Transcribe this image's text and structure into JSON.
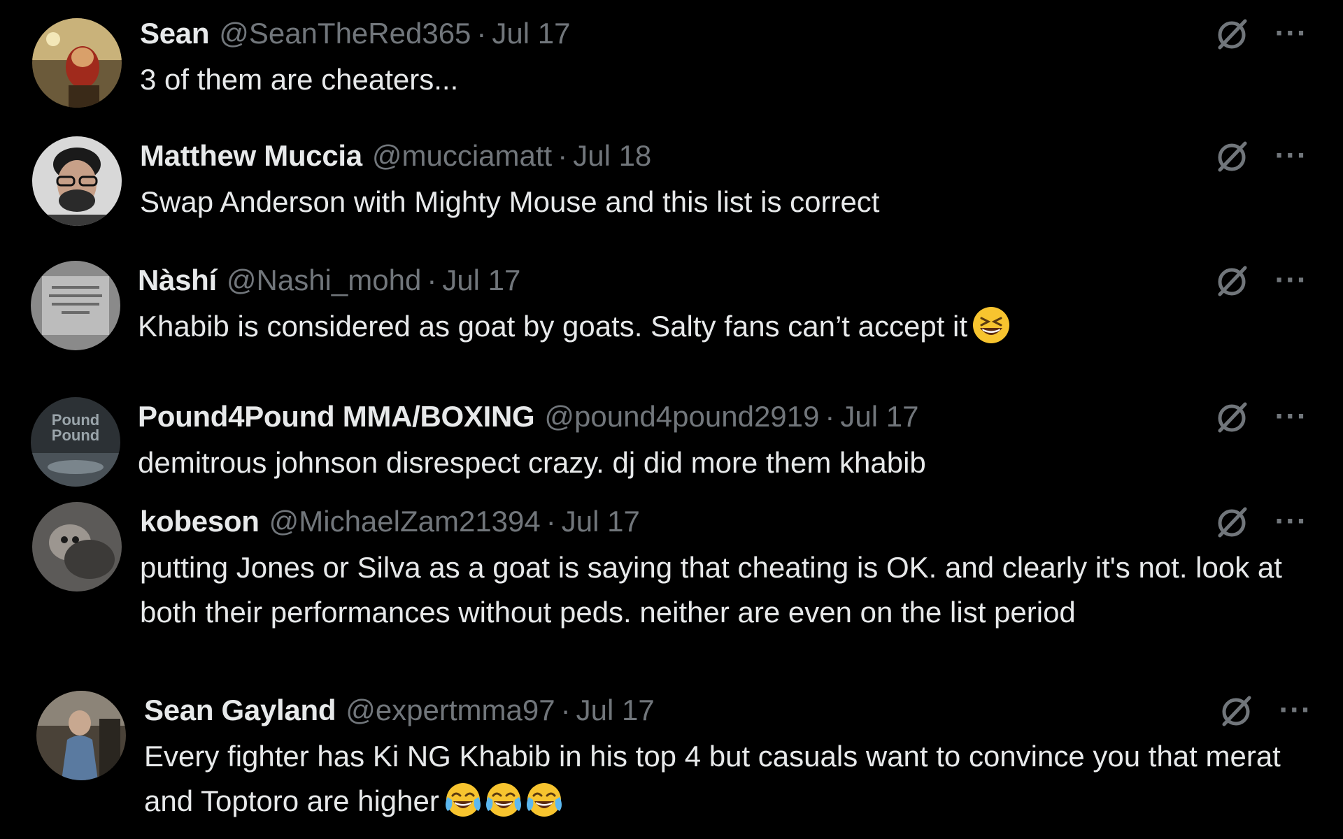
{
  "replies": [
    {
      "name": "Sean",
      "handle": "@SeanTheRed365",
      "separator": "·",
      "date": "Jul 17",
      "text": "3 of them are cheaters...",
      "emojis": []
    },
    {
      "name": "Matthew Muccia",
      "handle": "@mucciamatt",
      "separator": "·",
      "date": "Jul 18",
      "text": "Swap Anderson with Mighty Mouse and this list is correct",
      "emojis": []
    },
    {
      "name": "Nàshí",
      "handle": "@Nashi_mohd",
      "separator": "·",
      "date": "Jul 17",
      "text": "Khabib is considered as goat by goats. Salty fans can’t accept it",
      "emojis": [
        "grinning-squinting-face"
      ]
    },
    {
      "name": "Pound4Pound MMA/BOXING",
      "handle": "@pound4pound2919",
      "separator": "·",
      "date": "Jul 17",
      "text": "demitrous johnson disrespect crazy. dj did more them khabib",
      "emojis": []
    },
    {
      "name": "kobeson",
      "handle": "@MichaelZam21394",
      "separator": "·",
      "date": "Jul 17",
      "text": "putting Jones or Silva as a goat is saying that cheating is OK. and clearly it's not. look at both their performances without peds.  neither are even on the list period",
      "emojis": []
    },
    {
      "name": "Sean Gayland",
      "handle": "@expertmma97",
      "separator": "·",
      "date": "Jul 17",
      "text": "Every fighter has Ki NG Khabib in his top 4 but casuals want to convince you that merat and Toptoro are higher",
      "emojis": [
        "face-with-tears-of-joy",
        "face-with-tears-of-joy",
        "face-with-tears-of-joy"
      ]
    }
  ],
  "icons": {
    "grok": "grok-icon",
    "more": "more-icon",
    "more_glyph": "···"
  },
  "colors": {
    "background": "#000000",
    "primary_text": "#e7e9ea",
    "secondary_text": "#71767b"
  }
}
